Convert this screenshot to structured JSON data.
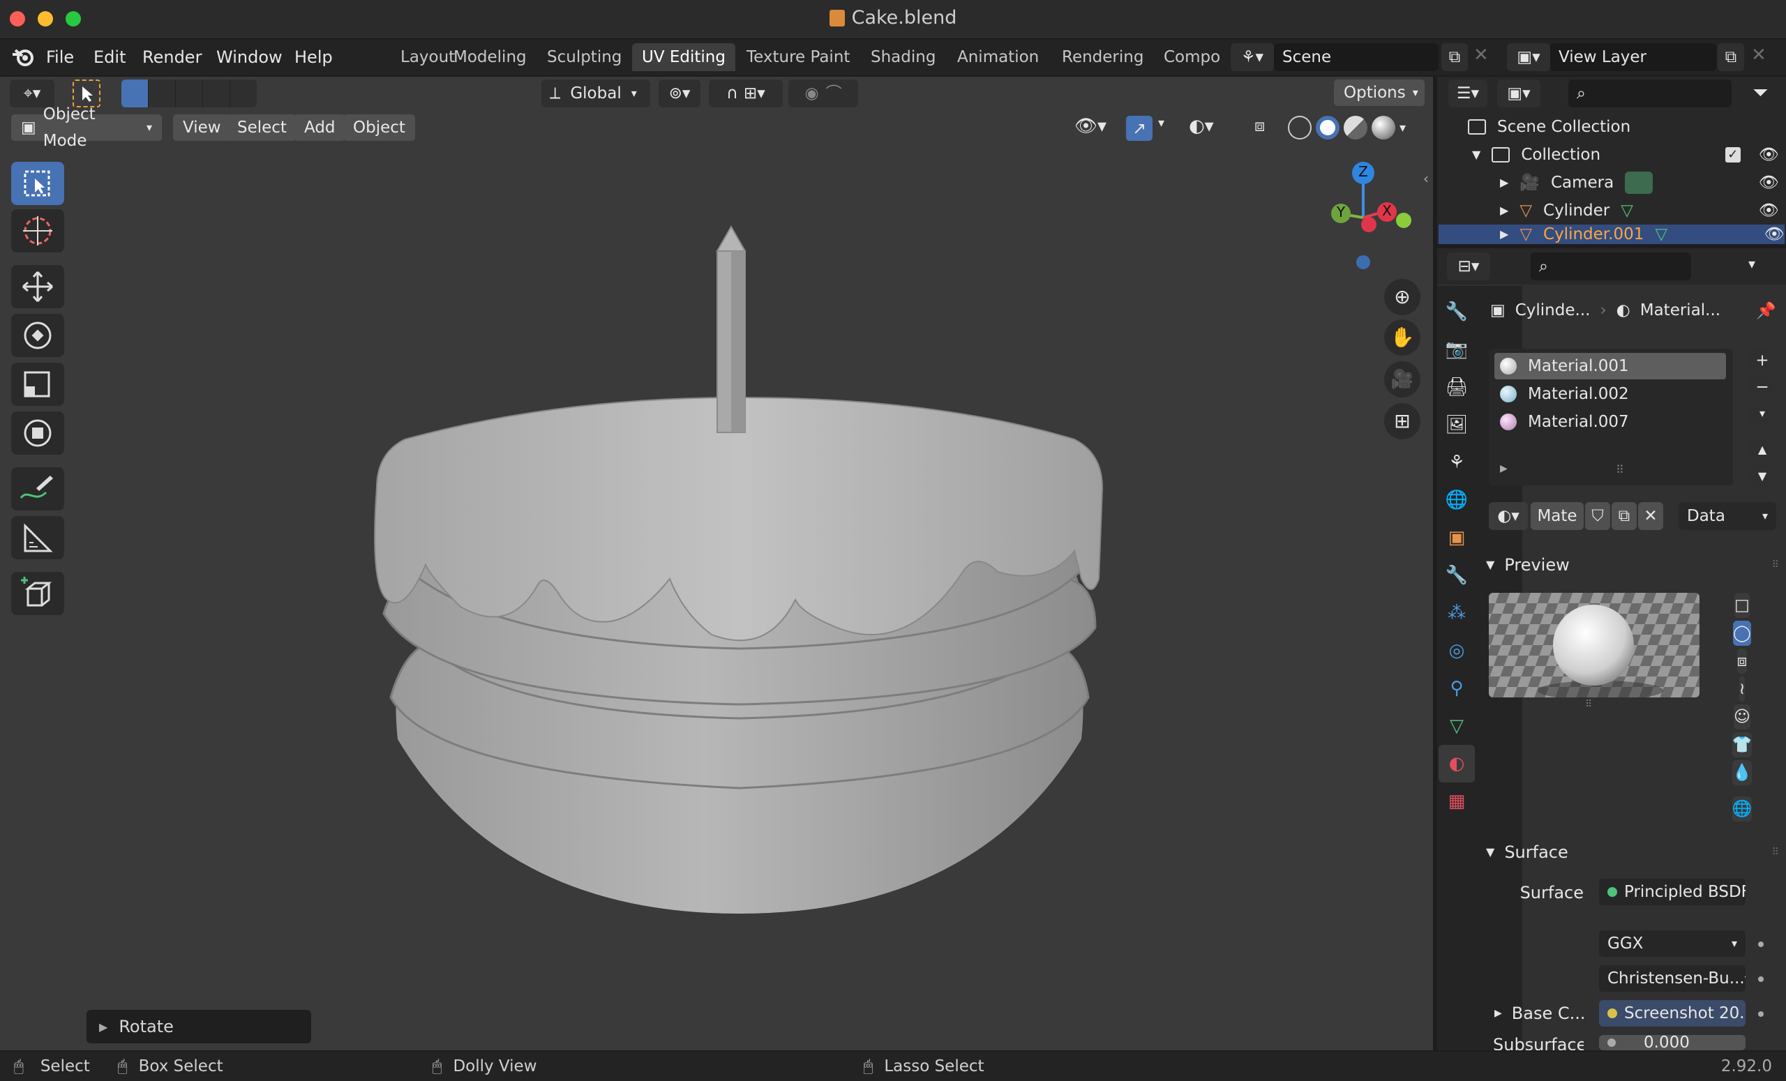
{
  "window": {
    "title": "Cake.blend"
  },
  "menu": [
    "File",
    "Edit",
    "Render",
    "Window",
    "Help"
  ],
  "workspaces": [
    {
      "label": "Layout",
      "active": false
    },
    {
      "label": "Modeling",
      "active": false
    },
    {
      "label": "Sculpting",
      "active": false
    },
    {
      "label": "UV Editing",
      "active": true
    },
    {
      "label": "Texture Paint",
      "active": false
    },
    {
      "label": "Shading",
      "active": false
    },
    {
      "label": "Animation",
      "active": false
    },
    {
      "label": "Rendering",
      "active": false
    },
    {
      "label": "Compo",
      "active": false
    }
  ],
  "scene": {
    "name": "Scene"
  },
  "view_layer": {
    "name": "View Layer"
  },
  "viewport": {
    "transform_orientation": "Global",
    "options_label": "Options",
    "mode": "Object Mode",
    "header_menus": [
      "View",
      "Select",
      "Add",
      "Object"
    ],
    "gizmo": {
      "z": "Z",
      "y": "Y",
      "x": "X"
    },
    "last_operator": "Rotate"
  },
  "outliner": {
    "root": "Scene Collection",
    "collection": "Collection",
    "objects": [
      {
        "name": "Camera",
        "selected": false
      },
      {
        "name": "Cylinder",
        "selected": false
      },
      {
        "name": "Cylinder.001",
        "selected": true
      }
    ]
  },
  "properties": {
    "breadcrumb_object": "Cylinde...",
    "breadcrumb_material": "Material...",
    "material_slots": [
      {
        "name": "Material.001",
        "color": "#dcdcdc",
        "selected": true
      },
      {
        "name": "Material.002",
        "color": "#9fd2e6",
        "selected": false
      },
      {
        "name": "Material.007",
        "color": "#d9a8d6",
        "selected": false
      }
    ],
    "material_name_field": "Mate",
    "link_dropdown": "Data",
    "preview_label": "Preview",
    "surface_panel_label": "Surface",
    "surface_label": "Surface",
    "surface_shader": "Principled BSDF",
    "distribution": "GGX",
    "subsurface_method": "Christensen-Bu...",
    "base_color_label": "Base C...",
    "base_color_value": "Screenshot 20...",
    "subsurface_label": "Subsurface",
    "subsurface_value": "0.000"
  },
  "statusbar": {
    "left_action": "Select",
    "middle_action": "Box Select",
    "dolly_action": "Dolly View",
    "lasso_action": "Lasso Select",
    "version": "2.92.0"
  },
  "colors": {
    "accent": "#4772b3",
    "active_object_text": "#ffa53f",
    "background_viewport": "#3a3a3a"
  }
}
